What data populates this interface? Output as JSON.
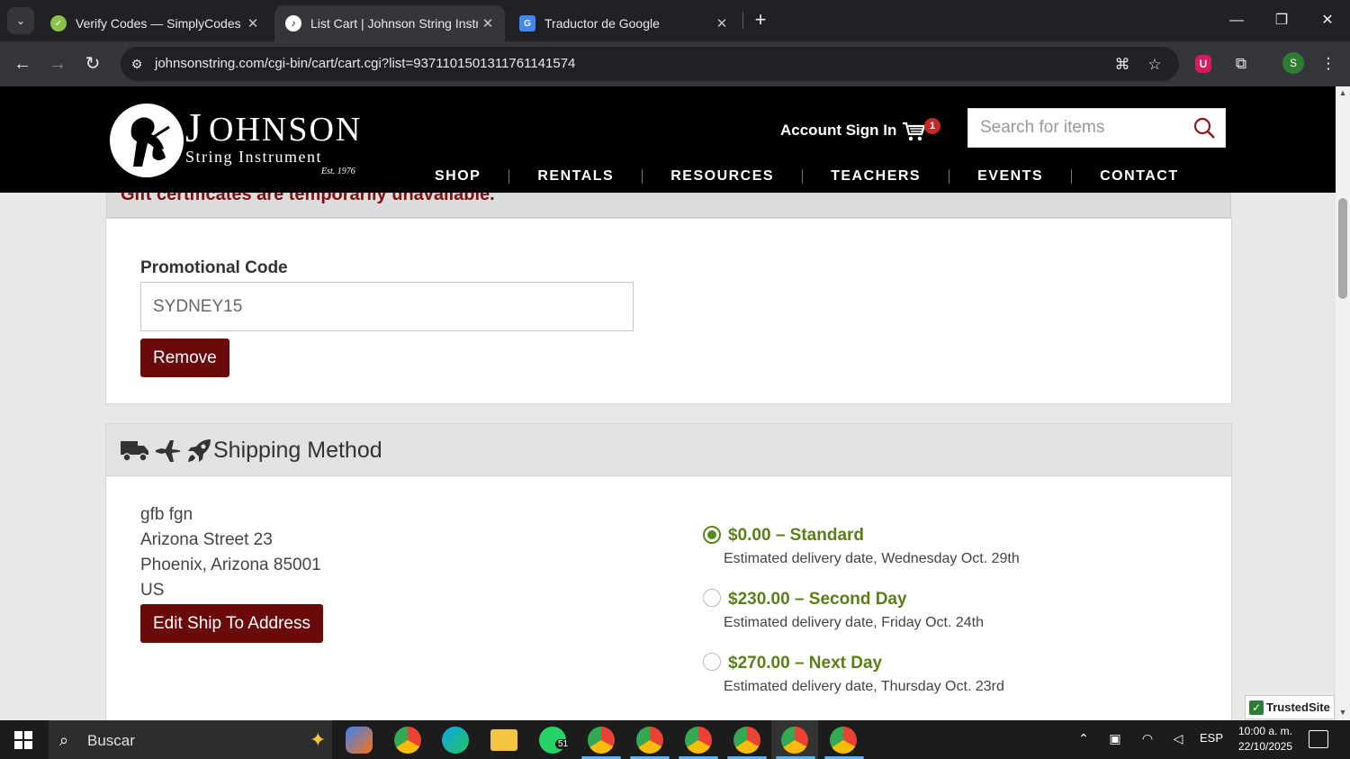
{
  "browser": {
    "tabs": [
      {
        "label": "Verify Codes — SimplyCodes",
        "favicon": "simplycodes-icon",
        "active": false
      },
      {
        "label": "List Cart | Johnson String Instru",
        "favicon": "johnson-icon",
        "active": true
      },
      {
        "label": "Traductor de Google",
        "favicon": "google-translate-icon",
        "active": false
      }
    ],
    "url": "johnsonstring.com/cgi-bin/cart/cart.cgi?list=937110150131176114​1574",
    "profile_initial": "S"
  },
  "site": {
    "logo": {
      "j": "J",
      "rest": "OHNSON",
      "sub": "String Instrument",
      "est": "Est. 1976"
    },
    "account_sign_in": "Account Sign In",
    "cart_count": "1",
    "search_placeholder": "Search for items",
    "nav": [
      "SHOP",
      "RENTALS",
      "RESOURCES",
      "TEACHERS",
      "EVENTS",
      "CONTACT"
    ]
  },
  "gift_notice": "Gift certificates are temporarily unavailable.",
  "promo": {
    "label": "Promotional Code",
    "value": "SYDNEY15",
    "remove_label": "Remove"
  },
  "shipping": {
    "title": "Shipping Method",
    "address": [
      "gfb fgn",
      "Arizona Street 23",
      "Phoenix, Arizona 85001",
      "US"
    ],
    "edit_label": "Edit Ship To Address",
    "options": [
      {
        "title": "$0.00 – Standard",
        "sub": "Estimated delivery date, Wednesday Oct. 29th",
        "checked": true
      },
      {
        "title": "$230.00 – Second Day",
        "sub": "Estimated delivery date, Friday Oct. 24th",
        "checked": false
      },
      {
        "title": "$270.00 – Next Day",
        "sub": "Estimated delivery date, Thursday Oct. 23rd",
        "checked": false
      }
    ]
  },
  "trusted_site": "TrustedSite",
  "taskbar": {
    "search_label": "Buscar",
    "whatsapp_badge": "51",
    "lang": "ESP",
    "time": "10:00 a. m.",
    "date": "22/10/2025"
  },
  "colors": {
    "maroon": "#6b0a0a",
    "gift_text": "#7b1113",
    "shipping_green": "#5a7f16"
  }
}
